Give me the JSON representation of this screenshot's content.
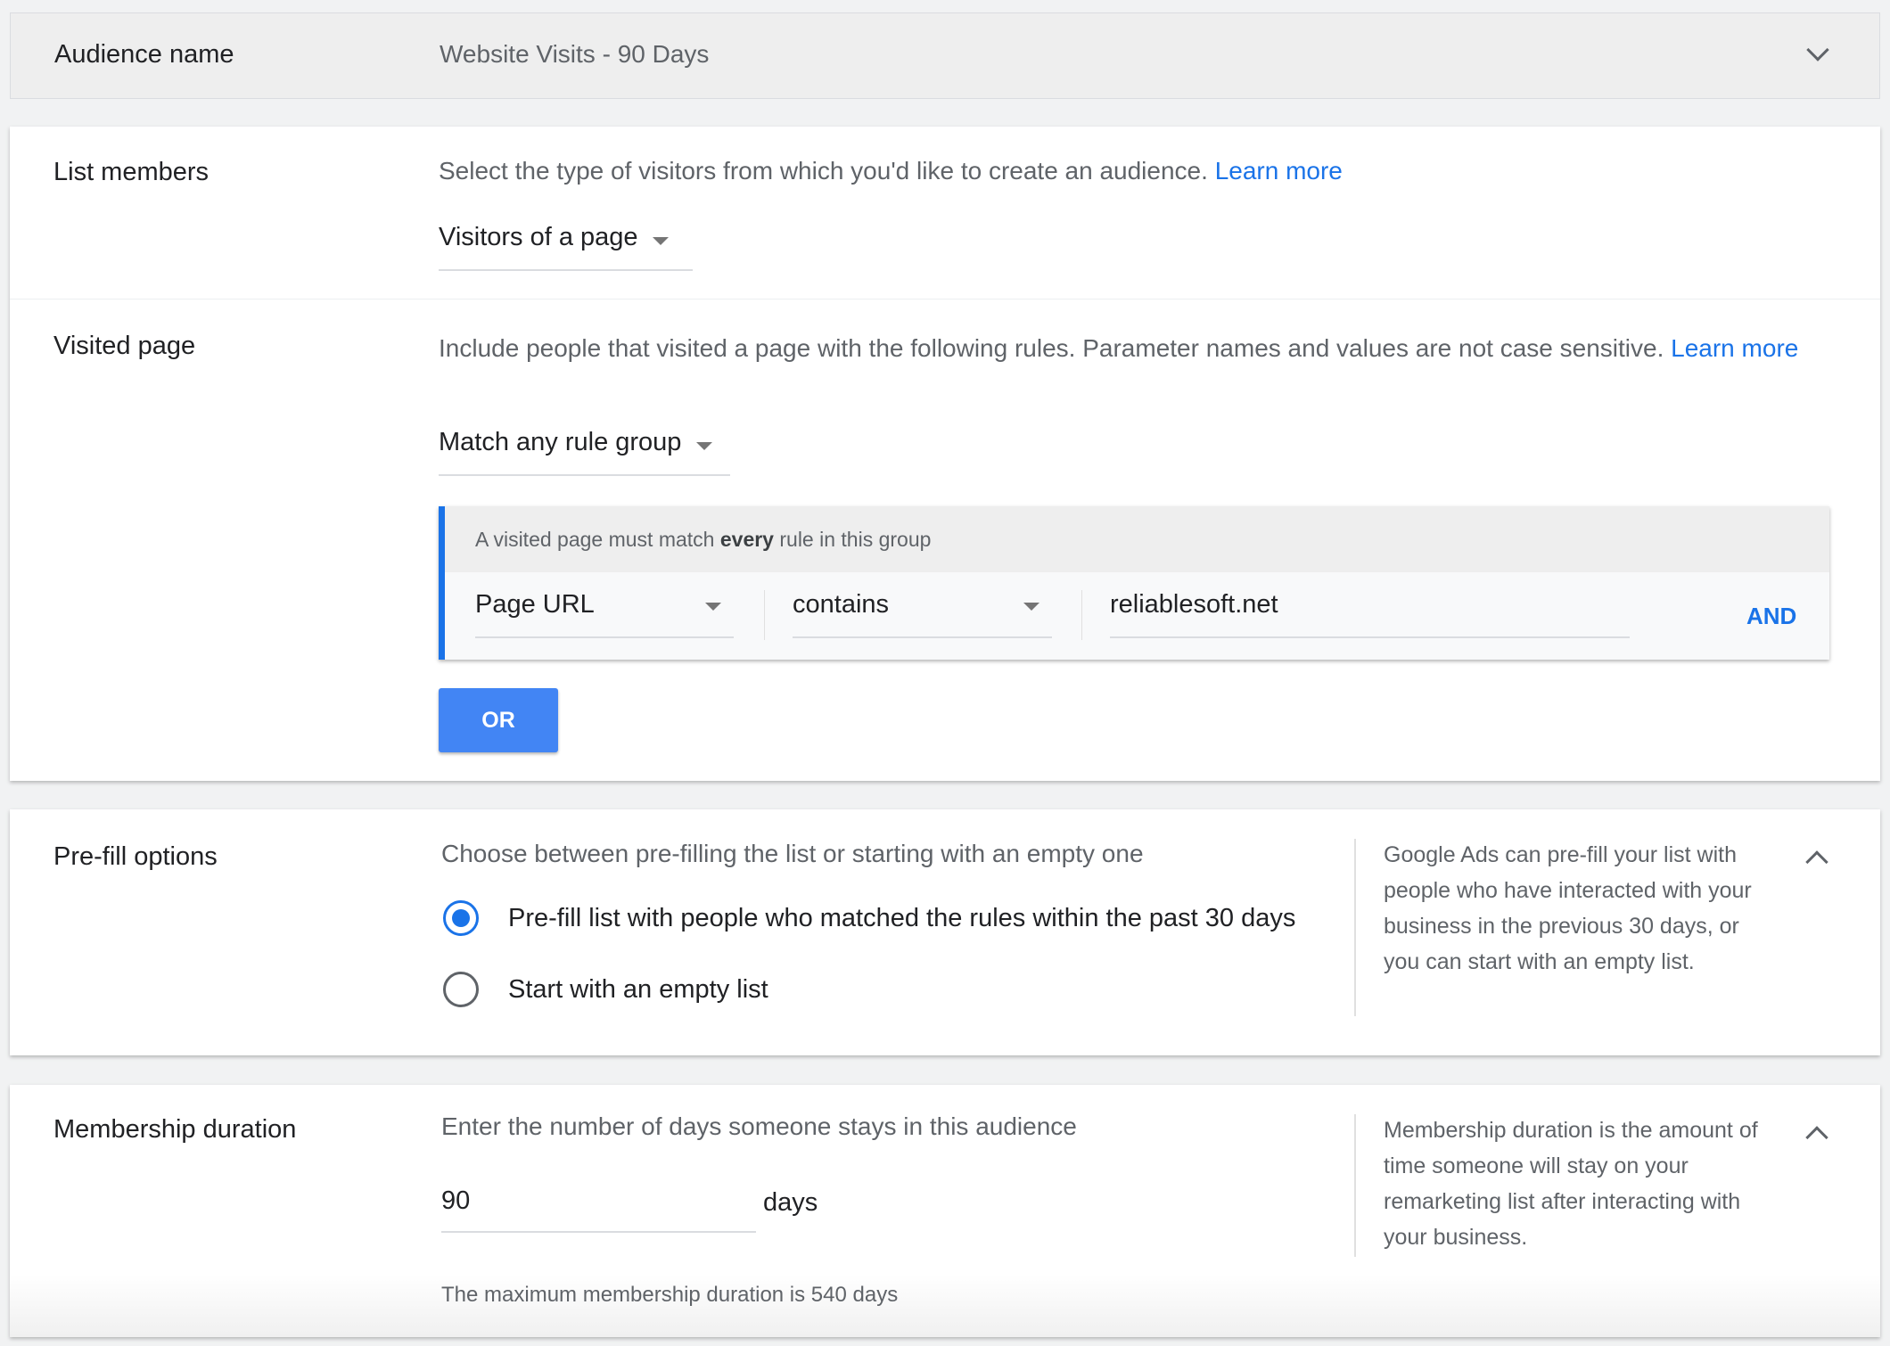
{
  "audience_name": {
    "label": "Audience name",
    "value": "Website Visits - 90 Days"
  },
  "list_members": {
    "label": "List members",
    "description": "Select the type of visitors from which you'd like to create an audience.",
    "learn_more": "Learn more",
    "dropdown_value": "Visitors of a page"
  },
  "visited_page": {
    "label": "Visited page",
    "description": "Include people that visited a page with the following rules. Parameter names and values are not case sensitive.",
    "learn_more_1": "Learn",
    "learn_more_2": "more",
    "match_dropdown": "Match any rule group",
    "rule_group": {
      "header_pre": "A visited page must match ",
      "header_bold": "every",
      "header_post": " rule in this group",
      "field": "Page URL",
      "operator": "contains",
      "value": "reliablesoft.net",
      "and_label": "AND"
    },
    "or_label": "OR"
  },
  "prefill": {
    "label": "Pre-fill options",
    "description": "Choose between pre-filling the list or starting with an empty one",
    "options": [
      {
        "label": "Pre-fill list with people who matched the rules within the past 30 days",
        "selected": true
      },
      {
        "label": "Start with an empty list",
        "selected": false
      }
    ],
    "help": "Google Ads can pre-fill your list with people who have interacted with your business in the previous 30 days, or you can start with an empty list."
  },
  "membership": {
    "label": "Membership duration",
    "description": "Enter the number of days someone stays in this audience",
    "value": "90",
    "unit": "days",
    "note": "The maximum membership duration is 540 days",
    "help": "Membership duration is the amount of time someone will stay on your remarketing list after interacting with your business."
  },
  "colors": {
    "accent": "#1a73e8",
    "button": "#4285f4"
  }
}
